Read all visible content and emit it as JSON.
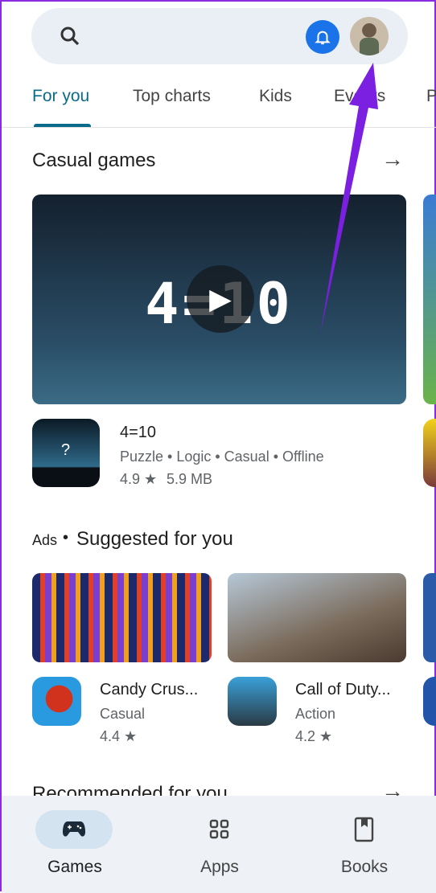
{
  "header": {
    "search_icon": "search-icon",
    "bell_icon": "bell-icon",
    "avatar": "profile-avatar"
  },
  "tabs": [
    {
      "label": "For you",
      "active": true
    },
    {
      "label": "Top charts"
    },
    {
      "label": "Kids"
    },
    {
      "label": "Events"
    },
    {
      "label": "P"
    }
  ],
  "casual": {
    "title": "Casual games",
    "video_text": "4=10",
    "app": {
      "name": "4=10",
      "tags": "Puzzle • Logic • Casual • Offline",
      "rating": "4.9",
      "size": "5.9 MB"
    }
  },
  "suggested": {
    "ads_label": "Ads",
    "title": "Suggested for you",
    "apps": [
      {
        "name": "Candy Crus...",
        "category": "Casual",
        "rating": "4.4"
      },
      {
        "name": "Call of Duty...",
        "category": "Action",
        "rating": "4.2"
      }
    ]
  },
  "recommended": {
    "title": "Recommended for you"
  },
  "bottom_nav": [
    {
      "label": "Games",
      "active": true
    },
    {
      "label": "Apps"
    },
    {
      "label": "Books"
    }
  ],
  "colors": {
    "accent": "#0b6b8a",
    "bell": "#1a73e8",
    "annotation_arrow": "#7b1fe0"
  }
}
